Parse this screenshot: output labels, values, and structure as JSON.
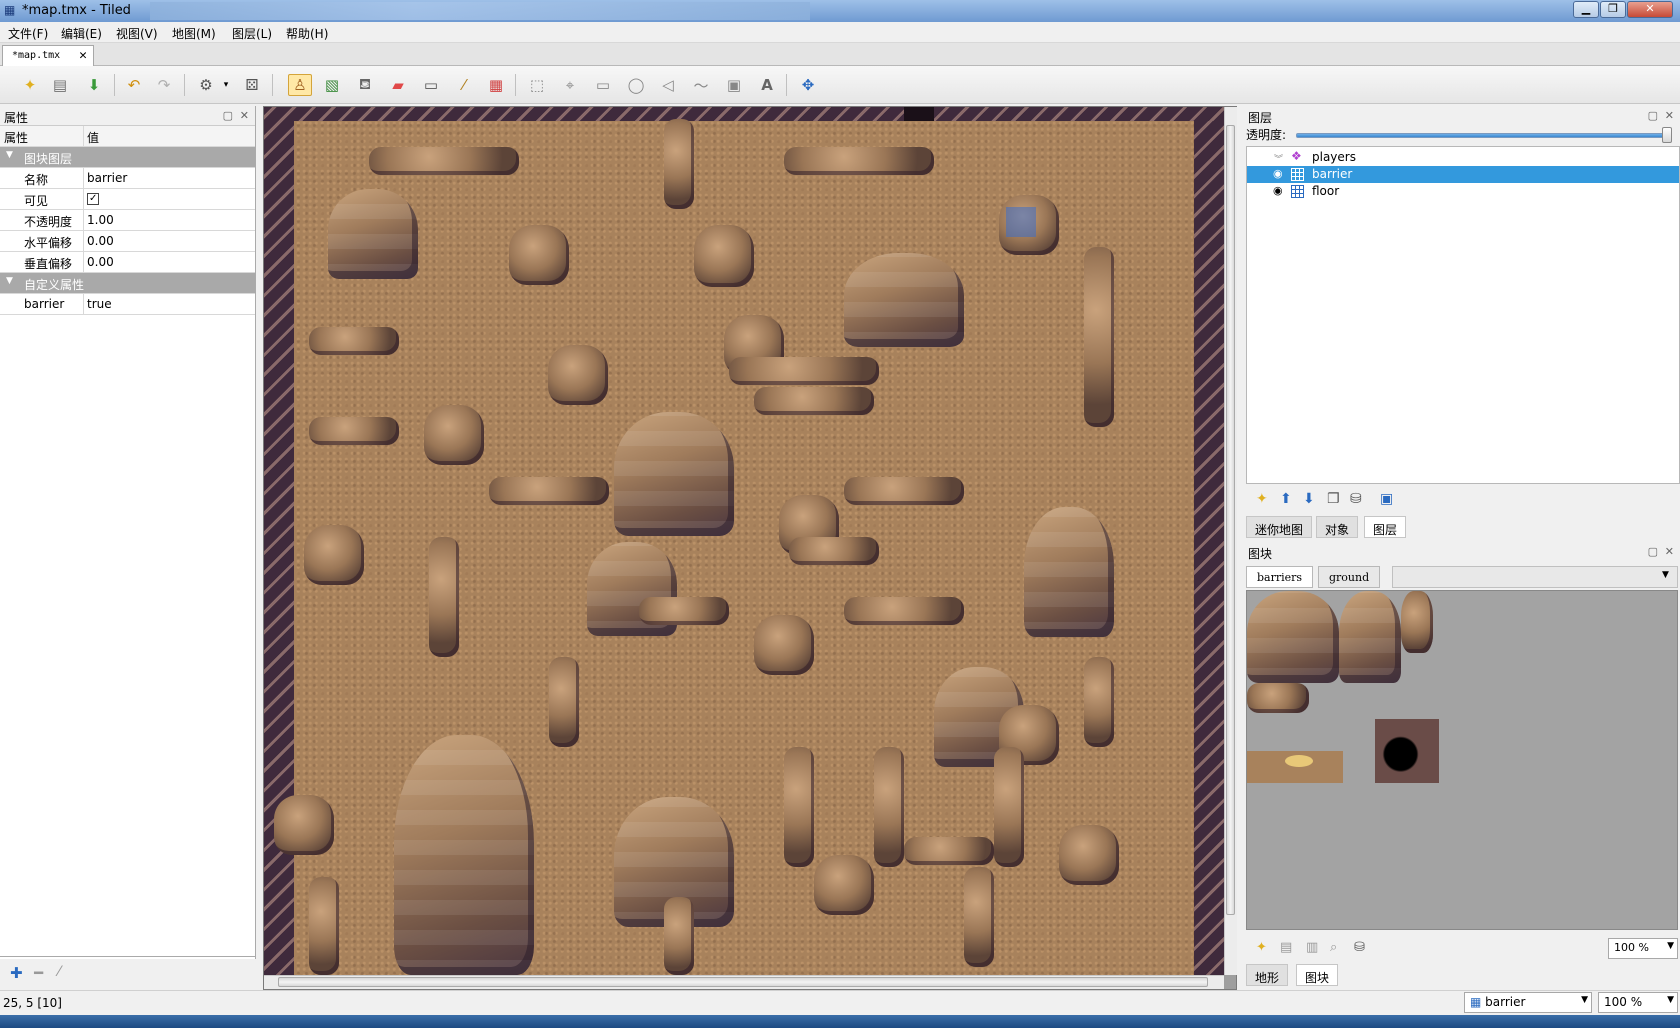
{
  "window": {
    "title": "*map.tmx - Tiled"
  },
  "menu": [
    "文件(F)",
    "编辑(E)",
    "视图(V)",
    "地图(M)",
    "图层(L)",
    "帮助(H)"
  ],
  "document_tab": "*map.tmx",
  "toolbar": {
    "icons": [
      "new-icon",
      "open-icon",
      "save-icon",
      "undo-icon",
      "redo-icon",
      "commands-icon",
      "random-icon",
      "stamp-brush-icon",
      "terrain-brush-icon",
      "bucket-fill-icon",
      "eraser-icon",
      "rectangle-select-icon",
      "magic-wand-icon",
      "select-same-tile-icon",
      "select-objects-icon",
      "edit-polygons-icon",
      "insert-rectangle-icon",
      "insert-ellipse-icon",
      "insert-polygon-icon",
      "insert-polyline-icon",
      "insert-tile-icon",
      "insert-text-icon",
      "move-icon"
    ]
  },
  "properties": {
    "title": "属性",
    "col_prop": "属性",
    "col_value": "值",
    "group_tile_layer": "图块图层",
    "rows": [
      {
        "key": "名称",
        "value": "barrier"
      },
      {
        "key": "可见",
        "value": "✓"
      },
      {
        "key": "不透明度",
        "value": "1.00"
      },
      {
        "key": "水平偏移",
        "value": "0.00"
      },
      {
        "key": "垂直偏移",
        "value": "0.00"
      }
    ],
    "group_custom": "自定义属性",
    "custom_rows": [
      {
        "key": "barrier",
        "value": "true"
      }
    ]
  },
  "layers": {
    "title": "图层",
    "opacity_label": "透明度:",
    "opacity": 1.0,
    "items": [
      {
        "name": "players",
        "type": "object",
        "selected": false
      },
      {
        "name": "barrier",
        "type": "tile",
        "selected": true
      },
      {
        "name": "floor",
        "type": "tile",
        "selected": false
      }
    ],
    "tabs": [
      "迷你地图",
      "对象",
      "图层"
    ],
    "active_tab": "图层"
  },
  "tilesets": {
    "title": "图块",
    "tabs": [
      "barriers",
      "ground"
    ],
    "zoom": "100 %",
    "bottom_tabs": [
      "地形",
      "图块"
    ],
    "active_bottom": "图块"
  },
  "status": {
    "coords": "25, 5 [10]",
    "layer_select": "barrier",
    "zoom": "100 %"
  },
  "colors": {
    "selection": "#3399dd",
    "floor": "#a8825c",
    "rock": "#9a7656",
    "wall": "#3f2a3c"
  }
}
